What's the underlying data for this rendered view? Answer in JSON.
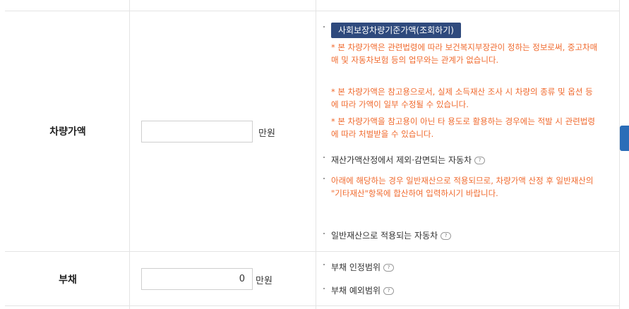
{
  "vehicle_row": {
    "label": "차량가액",
    "input_value": "",
    "unit": "만원",
    "lookup_button": "사회보장차량기준가액(조회하기)",
    "notes": [
      "* 본 차량가액은 관련법령에 따라 보건복지부장관이 정하는 정보로써, 중고차매매 및 자동차보험 등의 업무와는 관계가 없습니다.",
      "* 본 차량가액은 참고용으로서, 실제 소득재산 조사 시 차량의 종류 및 옵션 등에 따라 가액이 일부 수정될 수 있습니다.",
      "* 본 차량가액을 참고용이 아닌 타 용도로 활용하는 경우에는 적발 시 관련법령에 따라 처벌받을 수 있습니다."
    ],
    "excluded_link": "재산가액산정에서 제외·감면되는 자동차",
    "general_notice": "아래에 해당하는 경우 일반재산으로 적용되므로, 차량가액 산정 후 일반재산의 \"기타재산\"항목에 합산하여 입력하시기 바랍니다.",
    "general_link": "일반재산으로 적용되는 자동차"
  },
  "debt_row": {
    "label": "부채",
    "input_value": "0",
    "unit": "만원",
    "recognized_link": "부채 인정범위",
    "excluded_link": "부채 예외범위"
  },
  "help_icon_glyph": "?",
  "colors": {
    "button_bg": "#2f4a7d",
    "warning_text": "#f06a2e",
    "side_tab": "#2a6db8"
  }
}
